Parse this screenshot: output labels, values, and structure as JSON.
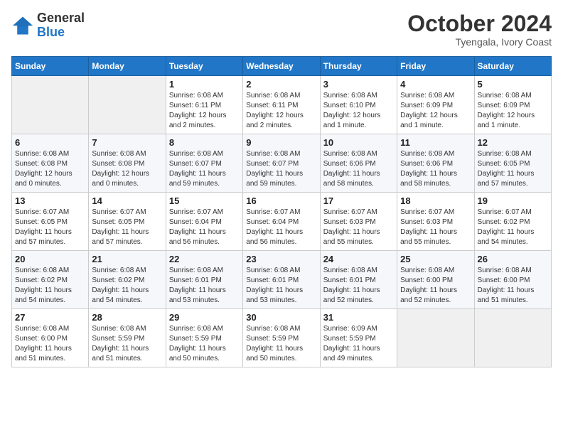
{
  "logo": {
    "line1": "General",
    "line2": "Blue"
  },
  "title": "October 2024",
  "subtitle": "Tyengala, Ivory Coast",
  "days_header": [
    "Sunday",
    "Monday",
    "Tuesday",
    "Wednesday",
    "Thursday",
    "Friday",
    "Saturday"
  ],
  "weeks": [
    [
      {
        "day": "",
        "info": ""
      },
      {
        "day": "",
        "info": ""
      },
      {
        "day": "1",
        "info": "Sunrise: 6:08 AM\nSunset: 6:11 PM\nDaylight: 12 hours\nand 2 minutes."
      },
      {
        "day": "2",
        "info": "Sunrise: 6:08 AM\nSunset: 6:11 PM\nDaylight: 12 hours\nand 2 minutes."
      },
      {
        "day": "3",
        "info": "Sunrise: 6:08 AM\nSunset: 6:10 PM\nDaylight: 12 hours\nand 1 minute."
      },
      {
        "day": "4",
        "info": "Sunrise: 6:08 AM\nSunset: 6:09 PM\nDaylight: 12 hours\nand 1 minute."
      },
      {
        "day": "5",
        "info": "Sunrise: 6:08 AM\nSunset: 6:09 PM\nDaylight: 12 hours\nand 1 minute."
      }
    ],
    [
      {
        "day": "6",
        "info": "Sunrise: 6:08 AM\nSunset: 6:08 PM\nDaylight: 12 hours\nand 0 minutes."
      },
      {
        "day": "7",
        "info": "Sunrise: 6:08 AM\nSunset: 6:08 PM\nDaylight: 12 hours\nand 0 minutes."
      },
      {
        "day": "8",
        "info": "Sunrise: 6:08 AM\nSunset: 6:07 PM\nDaylight: 11 hours\nand 59 minutes."
      },
      {
        "day": "9",
        "info": "Sunrise: 6:08 AM\nSunset: 6:07 PM\nDaylight: 11 hours\nand 59 minutes."
      },
      {
        "day": "10",
        "info": "Sunrise: 6:08 AM\nSunset: 6:06 PM\nDaylight: 11 hours\nand 58 minutes."
      },
      {
        "day": "11",
        "info": "Sunrise: 6:08 AM\nSunset: 6:06 PM\nDaylight: 11 hours\nand 58 minutes."
      },
      {
        "day": "12",
        "info": "Sunrise: 6:08 AM\nSunset: 6:05 PM\nDaylight: 11 hours\nand 57 minutes."
      }
    ],
    [
      {
        "day": "13",
        "info": "Sunrise: 6:07 AM\nSunset: 6:05 PM\nDaylight: 11 hours\nand 57 minutes."
      },
      {
        "day": "14",
        "info": "Sunrise: 6:07 AM\nSunset: 6:05 PM\nDaylight: 11 hours\nand 57 minutes."
      },
      {
        "day": "15",
        "info": "Sunrise: 6:07 AM\nSunset: 6:04 PM\nDaylight: 11 hours\nand 56 minutes."
      },
      {
        "day": "16",
        "info": "Sunrise: 6:07 AM\nSunset: 6:04 PM\nDaylight: 11 hours\nand 56 minutes."
      },
      {
        "day": "17",
        "info": "Sunrise: 6:07 AM\nSunset: 6:03 PM\nDaylight: 11 hours\nand 55 minutes."
      },
      {
        "day": "18",
        "info": "Sunrise: 6:07 AM\nSunset: 6:03 PM\nDaylight: 11 hours\nand 55 minutes."
      },
      {
        "day": "19",
        "info": "Sunrise: 6:07 AM\nSunset: 6:02 PM\nDaylight: 11 hours\nand 54 minutes."
      }
    ],
    [
      {
        "day": "20",
        "info": "Sunrise: 6:08 AM\nSunset: 6:02 PM\nDaylight: 11 hours\nand 54 minutes."
      },
      {
        "day": "21",
        "info": "Sunrise: 6:08 AM\nSunset: 6:02 PM\nDaylight: 11 hours\nand 54 minutes."
      },
      {
        "day": "22",
        "info": "Sunrise: 6:08 AM\nSunset: 6:01 PM\nDaylight: 11 hours\nand 53 minutes."
      },
      {
        "day": "23",
        "info": "Sunrise: 6:08 AM\nSunset: 6:01 PM\nDaylight: 11 hours\nand 53 minutes."
      },
      {
        "day": "24",
        "info": "Sunrise: 6:08 AM\nSunset: 6:01 PM\nDaylight: 11 hours\nand 52 minutes."
      },
      {
        "day": "25",
        "info": "Sunrise: 6:08 AM\nSunset: 6:00 PM\nDaylight: 11 hours\nand 52 minutes."
      },
      {
        "day": "26",
        "info": "Sunrise: 6:08 AM\nSunset: 6:00 PM\nDaylight: 11 hours\nand 51 minutes."
      }
    ],
    [
      {
        "day": "27",
        "info": "Sunrise: 6:08 AM\nSunset: 6:00 PM\nDaylight: 11 hours\nand 51 minutes."
      },
      {
        "day": "28",
        "info": "Sunrise: 6:08 AM\nSunset: 5:59 PM\nDaylight: 11 hours\nand 51 minutes."
      },
      {
        "day": "29",
        "info": "Sunrise: 6:08 AM\nSunset: 5:59 PM\nDaylight: 11 hours\nand 50 minutes."
      },
      {
        "day": "30",
        "info": "Sunrise: 6:08 AM\nSunset: 5:59 PM\nDaylight: 11 hours\nand 50 minutes."
      },
      {
        "day": "31",
        "info": "Sunrise: 6:09 AM\nSunset: 5:59 PM\nDaylight: 11 hours\nand 49 minutes."
      },
      {
        "day": "",
        "info": ""
      },
      {
        "day": "",
        "info": ""
      }
    ]
  ]
}
